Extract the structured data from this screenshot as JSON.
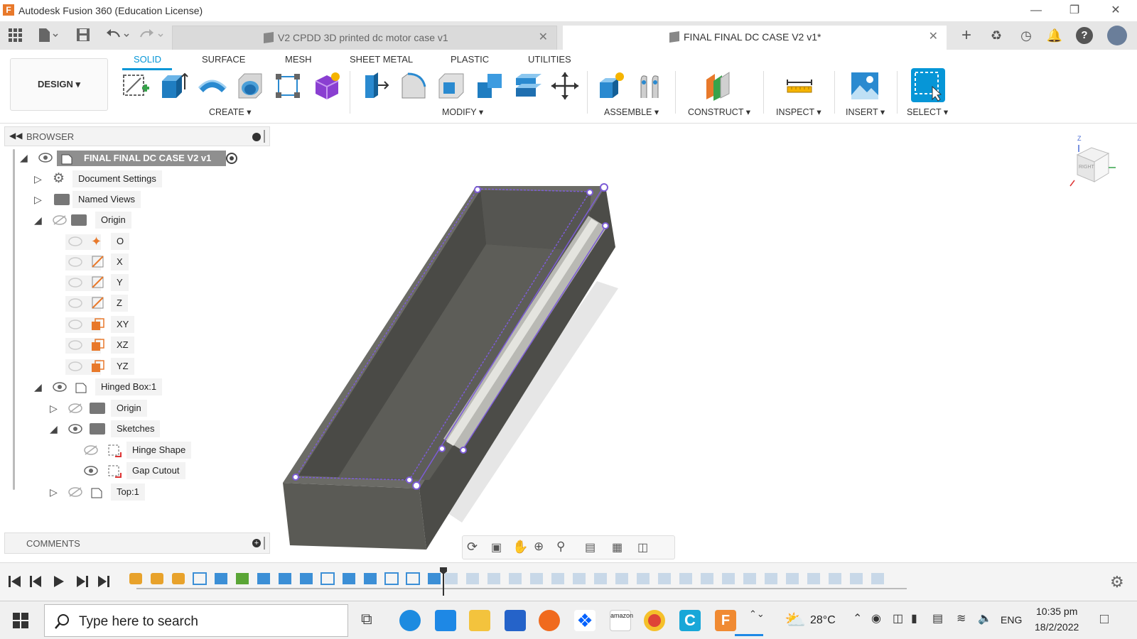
{
  "app": {
    "title": "Autodesk Fusion 360 (Education License)",
    "icon_letter": "F"
  },
  "tabs": [
    {
      "label": "V2 CPDD 3D printed dc motor case v1",
      "active": false
    },
    {
      "label": "FINAL FINAL DC CASE V2 v1*",
      "active": true
    }
  ],
  "ribbon": {
    "workspace": "DESIGN",
    "tabs": [
      "SOLID",
      "SURFACE",
      "MESH",
      "SHEET METAL",
      "PLASTIC",
      "UTILITIES"
    ],
    "active_tab": "SOLID",
    "groups": {
      "create": "CREATE",
      "modify": "MODIFY",
      "assemble": "ASSEMBLE",
      "construct": "CONSTRUCT",
      "inspect": "INSPECT",
      "insert": "INSERT",
      "select": "SELECT"
    }
  },
  "browser": {
    "header": "BROWSER",
    "root": "FINAL FINAL DC CASE V2 v1",
    "items": [
      {
        "label": "Document Settings"
      },
      {
        "label": "Named Views"
      },
      {
        "label": "Origin"
      },
      {
        "label": "O"
      },
      {
        "label": "X"
      },
      {
        "label": "Y"
      },
      {
        "label": "Z"
      },
      {
        "label": "XY"
      },
      {
        "label": "XZ"
      },
      {
        "label": "YZ"
      },
      {
        "label": "Hinged Box:1"
      },
      {
        "label": "Origin"
      },
      {
        "label": "Sketches"
      },
      {
        "label": "Hinge Shape"
      },
      {
        "label": "Gap Cutout"
      },
      {
        "label": "Top:1"
      }
    ]
  },
  "comments": {
    "header": "COMMENTS"
  },
  "viewcube": {
    "face": "RIGHT",
    "axis_label": "Z"
  },
  "taskbar": {
    "search_placeholder": "Type here to search",
    "weather": "28°C",
    "language": "ENG",
    "time": "10:35 pm",
    "date": "18/2/2022",
    "amazon": "amazon"
  },
  "colors": {
    "accent": "#0696d7",
    "model": "#5f5f5b",
    "sketch": "#7c5cd6"
  }
}
